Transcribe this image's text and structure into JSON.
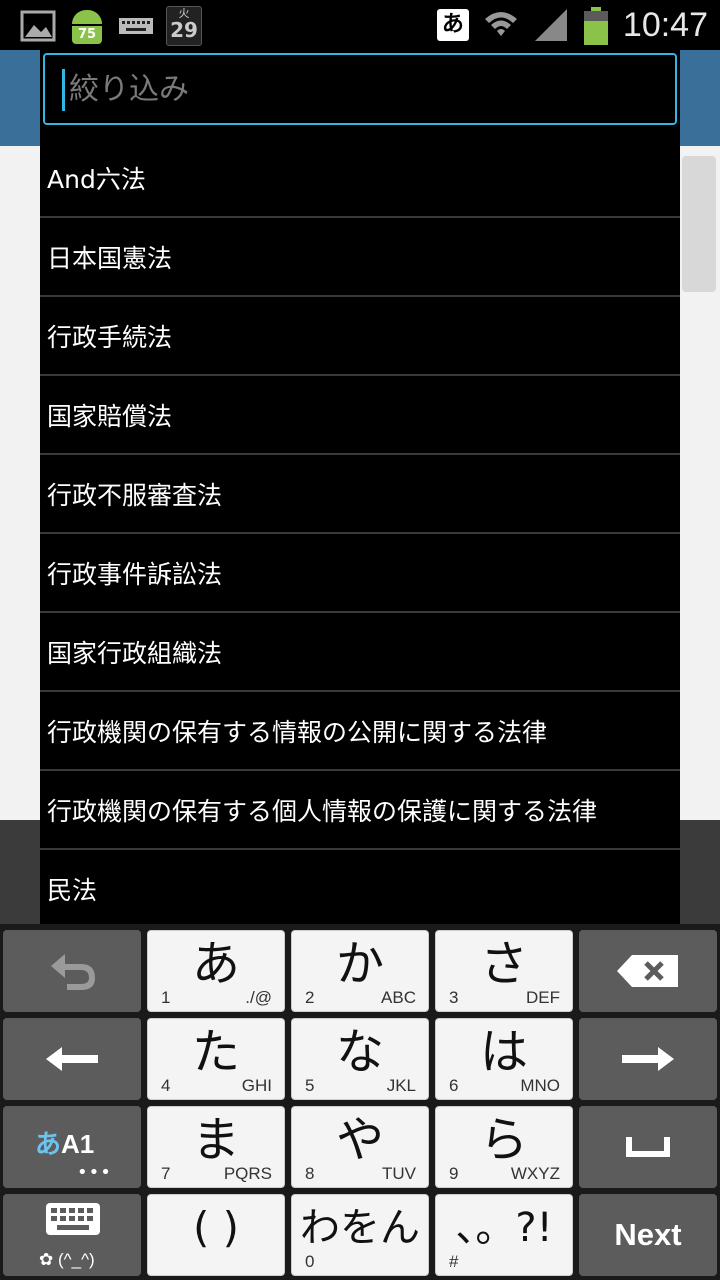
{
  "status_bar": {
    "battery_badge": "75",
    "calendar_day_label": "火",
    "calendar_day_number": "29",
    "ime_indicator": "あ",
    "time": "10:47"
  },
  "filter": {
    "placeholder": "絞り込み",
    "value": ""
  },
  "law_list": [
    {
      "label": "And六法"
    },
    {
      "label": "日本国憲法"
    },
    {
      "label": "行政手続法"
    },
    {
      "label": "国家賠償法"
    },
    {
      "label": "行政不服審査法"
    },
    {
      "label": "行政事件訴訟法"
    },
    {
      "label": "国家行政組織法"
    },
    {
      "label": "行政機関の保有する情報の公開に関する法律"
    },
    {
      "label": "行政機関の保有する個人情報の保護に関する法律"
    },
    {
      "label": "民法"
    }
  ],
  "keyboard": {
    "keys": {
      "a": {
        "main": "あ",
        "num": "1",
        "sub": "./@"
      },
      "ka": {
        "main": "か",
        "num": "2",
        "sub": "ABC"
      },
      "sa": {
        "main": "さ",
        "num": "3",
        "sub": "DEF"
      },
      "ta": {
        "main": "た",
        "num": "4",
        "sub": "GHI"
      },
      "na": {
        "main": "な",
        "num": "5",
        "sub": "JKL"
      },
      "ha": {
        "main": "は",
        "num": "6",
        "sub": "MNO"
      },
      "ma": {
        "main": "ま",
        "num": "7",
        "sub": "PQRS"
      },
      "ya": {
        "main": "や",
        "num": "8",
        "sub": "TUV"
      },
      "ra": {
        "main": "ら",
        "num": "9",
        "sub": "WXYZ"
      },
      "paren": {
        "main": "( )"
      },
      "wa": {
        "main": "わをん",
        "num": "0"
      },
      "punct": {
        "main": "、。?!",
        "num": "#"
      }
    },
    "mode_label_a": "あ",
    "mode_label_rest": "A1",
    "mode_dots": "•••",
    "emoticon_label": "(^_^)",
    "next_label": "Next"
  }
}
